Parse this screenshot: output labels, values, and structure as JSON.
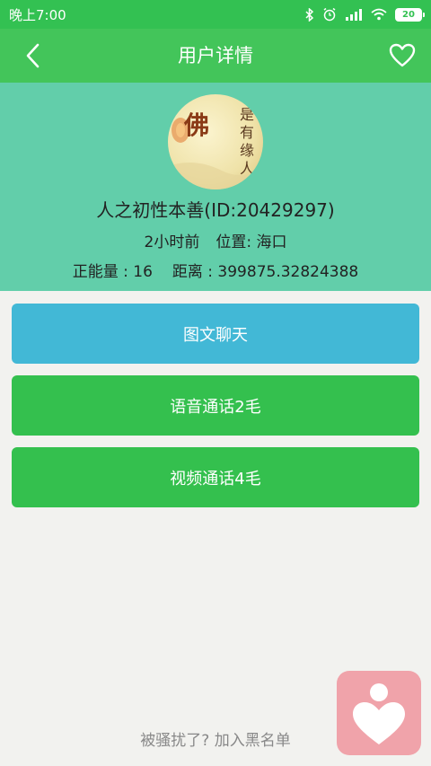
{
  "status_bar": {
    "time": "晚上7:00",
    "battery": "20"
  },
  "header": {
    "title": "用户详情"
  },
  "profile": {
    "name": "人之初性本善(ID:20429297)",
    "last_active": "2小时前",
    "location": "位置: 海口",
    "energy": "正能量 : 16",
    "distance": "距离 : 399875.32824388",
    "avatar_text": "佛 是有缘人"
  },
  "actions": {
    "chat": "图文聊天",
    "voice": "语音通话2毛",
    "video": "视频通话4毛"
  },
  "footer": {
    "blacklist": "被骚扰了? 加入黑名单"
  },
  "colors": {
    "status_bar": "#33c152",
    "header": "#43c55a",
    "profile_bg": "#62ceaa",
    "chat_button": "#42b8d6",
    "call_button": "#34c04e",
    "float_button": "#f0a3aa"
  }
}
